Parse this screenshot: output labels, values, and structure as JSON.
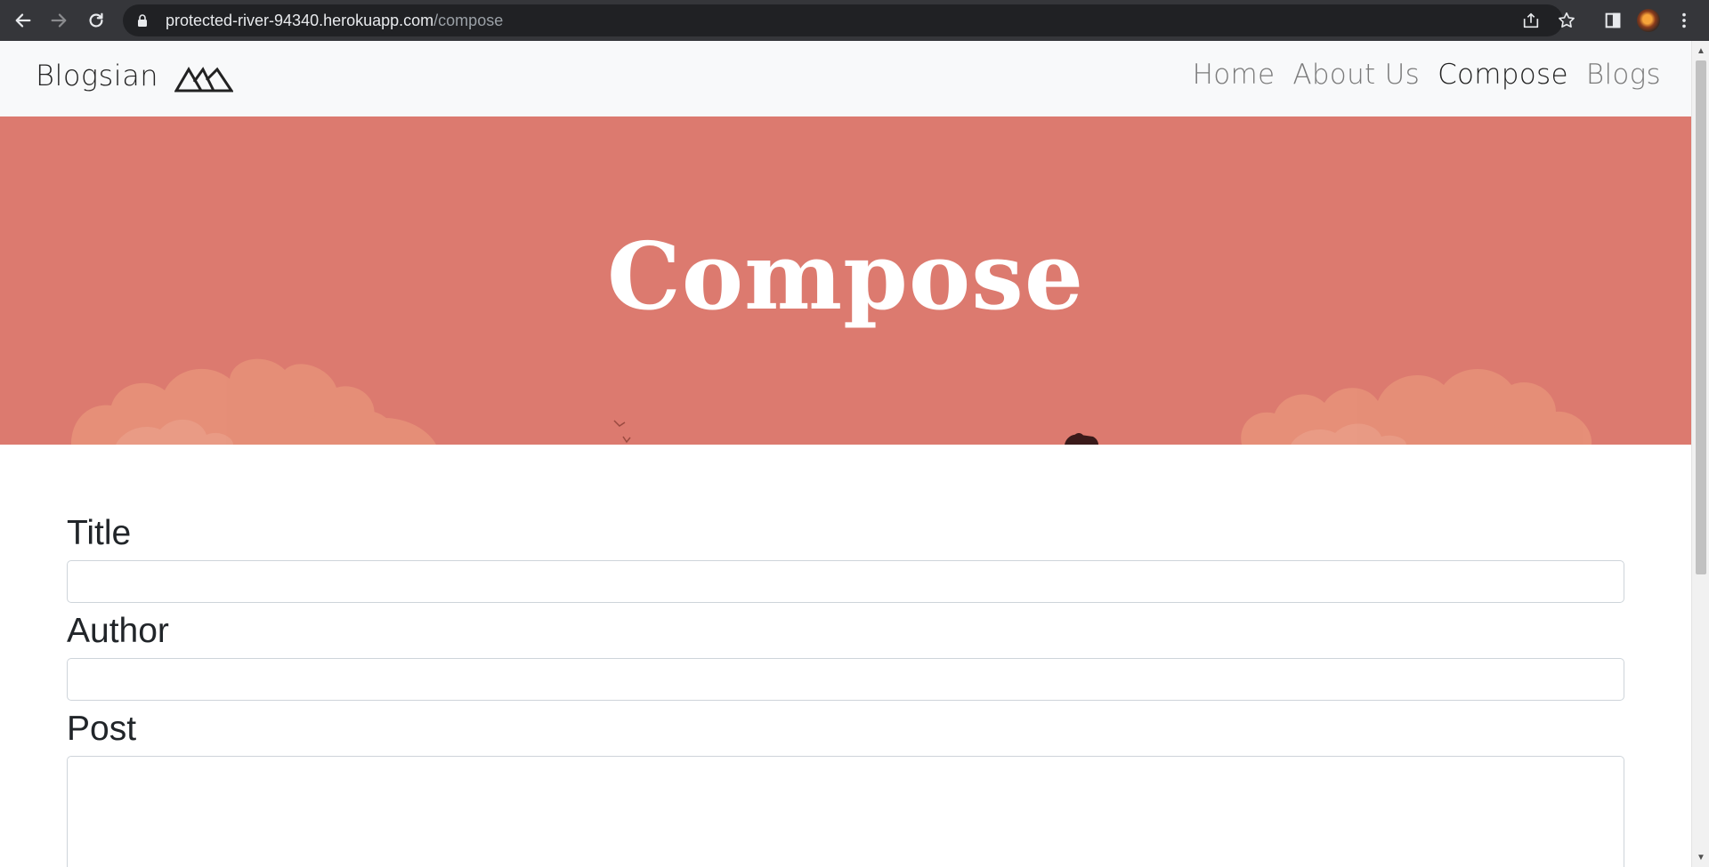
{
  "browser": {
    "url_host": "protected-river-94340.herokuapp.com",
    "url_path": "/compose"
  },
  "navbar": {
    "brand": "Blogsian",
    "links": [
      {
        "label": "Home",
        "active": false
      },
      {
        "label": "About Us",
        "active": false
      },
      {
        "label": "Compose",
        "active": true
      },
      {
        "label": "Blogs",
        "active": false
      }
    ]
  },
  "hero": {
    "title": "Compose",
    "background_color": "#dc7a6f"
  },
  "form": {
    "title_label": "Title",
    "title_value": "",
    "author_label": "Author",
    "author_value": "",
    "post_label": "Post",
    "post_value": ""
  },
  "icons": {
    "back": "arrow-left-icon",
    "forward": "arrow-right-icon",
    "reload": "reload-icon",
    "lock": "lock-icon",
    "share": "share-icon",
    "bookmark": "star-icon",
    "side_panel": "side-panel-icon",
    "profile": "avatar",
    "menu": "kebab-menu-icon",
    "brand_logo": "mountains-logo-icon"
  }
}
